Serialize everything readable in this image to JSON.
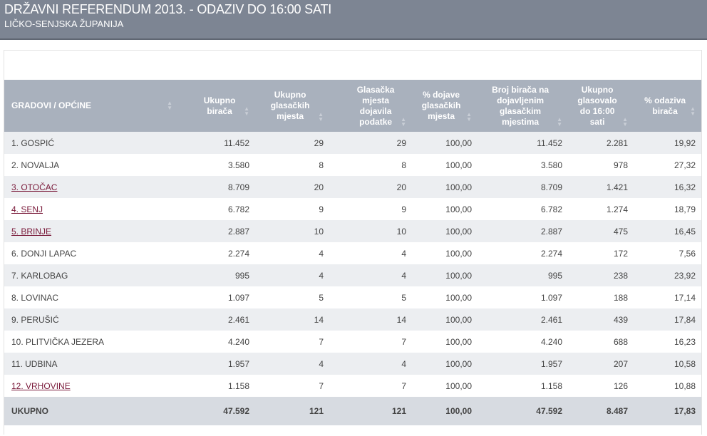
{
  "header": {
    "title": "DRŽAVNI REFERENDUM 2013. - ODAZIV DO 16:00 SATI",
    "subtitle": "LIČKO-SENJSKA ŽUPANIJA"
  },
  "table": {
    "columns": [
      "GRADOVI / OPĆINE",
      "Ukupno birača",
      "Ukupno glasačkih mjesta",
      "Glasačka mjesta dojavila podatke",
      "% dojave glasačkih mjesta",
      "Broj birača na dojavljenim glasačkim mjestima",
      "Ukupno glasovalo do 16:00 sati",
      "% odaziva birača"
    ],
    "rows": [
      {
        "name": "1. GOSPIĆ",
        "link": false,
        "birača": "11.452",
        "mjesta": "29",
        "dojavila": "29",
        "dojave": "100,00",
        "broj": "11.452",
        "glasovalo": "2.281",
        "odaziv": "19,92"
      },
      {
        "name": "2. NOVALJA",
        "link": false,
        "birača": "3.580",
        "mjesta": "8",
        "dojavila": "8",
        "dojave": "100,00",
        "broj": "3.580",
        "glasovalo": "978",
        "odaziv": "27,32"
      },
      {
        "name": "3. OTOČAC",
        "link": true,
        "birača": "8.709",
        "mjesta": "20",
        "dojavila": "20",
        "dojave": "100,00",
        "broj": "8.709",
        "glasovalo": "1.421",
        "odaziv": "16,32"
      },
      {
        "name": "4. SENJ",
        "link": true,
        "birača": "6.782",
        "mjesta": "9",
        "dojavila": "9",
        "dojave": "100,00",
        "broj": "6.782",
        "glasovalo": "1.274",
        "odaziv": "18,79"
      },
      {
        "name": "5. BRINJE",
        "link": true,
        "birača": "2.887",
        "mjesta": "10",
        "dojavila": "10",
        "dojave": "100,00",
        "broj": "2.887",
        "glasovalo": "475",
        "odaziv": "16,45"
      },
      {
        "name": "6. DONJI LAPAC",
        "link": false,
        "birača": "2.274",
        "mjesta": "4",
        "dojavila": "4",
        "dojave": "100,00",
        "broj": "2.274",
        "glasovalo": "172",
        "odaziv": "7,56"
      },
      {
        "name": "7. KARLOBAG",
        "link": false,
        "birača": "995",
        "mjesta": "4",
        "dojavila": "4",
        "dojave": "100,00",
        "broj": "995",
        "glasovalo": "238",
        "odaziv": "23,92"
      },
      {
        "name": "8. LOVINAC",
        "link": false,
        "birača": "1.097",
        "mjesta": "5",
        "dojavila": "5",
        "dojave": "100,00",
        "broj": "1.097",
        "glasovalo": "188",
        "odaziv": "17,14"
      },
      {
        "name": "9. PERUŠIĆ",
        "link": false,
        "birača": "2.461",
        "mjesta": "14",
        "dojavila": "14",
        "dojave": "100,00",
        "broj": "2.461",
        "glasovalo": "439",
        "odaziv": "17,84"
      },
      {
        "name": "10. PLITVIČKA JEZERA",
        "link": false,
        "birača": "4.240",
        "mjesta": "7",
        "dojavila": "7",
        "dojave": "100,00",
        "broj": "4.240",
        "glasovalo": "688",
        "odaziv": "16,23"
      },
      {
        "name": "11. UDBINA",
        "link": false,
        "birača": "1.957",
        "mjesta": "4",
        "dojavila": "4",
        "dojave": "100,00",
        "broj": "1.957",
        "glasovalo": "207",
        "odaziv": "10,58"
      },
      {
        "name": "12. VRHOVINE",
        "link": true,
        "birača": "1.158",
        "mjesta": "7",
        "dojavila": "7",
        "dojave": "100,00",
        "broj": "1.158",
        "glasovalo": "126",
        "odaziv": "10,88"
      }
    ],
    "total": {
      "name": "UKUPNO",
      "birača": "47.592",
      "mjesta": "121",
      "dojavila": "121",
      "dojave": "100,00",
      "broj": "47.592",
      "glasovalo": "8.487",
      "odaziv": "17,83"
    }
  },
  "colors": {
    "header_bg": "#7d8593",
    "table_header_bg": "#a9b1bd",
    "row_alt_bg": "#eceef1",
    "total_bg": "#d7dbe1",
    "link": "#7a1a3a"
  }
}
